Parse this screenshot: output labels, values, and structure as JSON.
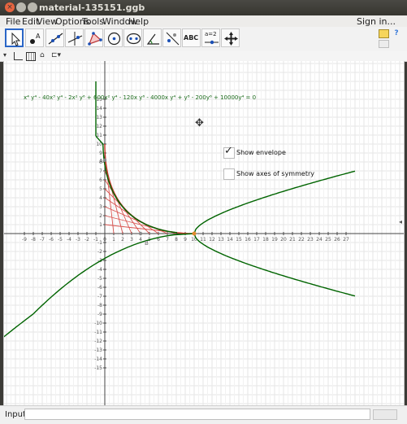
{
  "window": {
    "title": "material-135151.ggb"
  },
  "menus": [
    "File",
    "Edit",
    "View",
    "Options",
    "Tools",
    "Window",
    "Help"
  ],
  "signin": "Sign in...",
  "tools": {
    "text_tool_label": "ABC",
    "slider_label": "a=2"
  },
  "equation": "x⁴ y⁴ - 40x³ y⁴ - 2x² y⁶ + 600x² y⁴ - 120x y⁶ - 4000x y⁴ + y⁸ - 200y⁶ + 10000y⁴ = 0",
  "checkboxes": [
    {
      "label": "Show envelope",
      "checked": true
    },
    {
      "label": "Show axes of symmetry",
      "checked": false
    }
  ],
  "axes": {
    "x_ticks": [
      "-9",
      "-8",
      "-7",
      "-6",
      "-5",
      "-4",
      "-3",
      "-2",
      "-1",
      "0",
      "1",
      "2",
      "3",
      "4",
      "5",
      "6",
      "7",
      "8",
      "9",
      "10",
      "11",
      "12",
      "13",
      "14",
      "15",
      "16",
      "17",
      "18",
      "19",
      "20",
      "21",
      "22",
      "23",
      "24",
      "25",
      "26",
      "27"
    ],
    "y_ticks": [
      "15",
      "14",
      "13",
      "12",
      "11",
      "10",
      "9",
      "8",
      "7",
      "6",
      "5",
      "4",
      "3",
      "2",
      "1",
      "-1",
      "-2",
      "-3",
      "-4",
      "-5",
      "-6",
      "-7",
      "-8",
      "-9",
      "-10",
      "-11",
      "-12",
      "-13",
      "-14",
      "-15"
    ]
  },
  "point_labels": {
    "A": "A",
    "B": "B"
  },
  "input": {
    "label": "Input:",
    "value": ""
  },
  "colors": {
    "curve": "#006400",
    "envelope": "#c0392b",
    "lines": "#d4504b",
    "axis_labels": "#555555"
  }
}
